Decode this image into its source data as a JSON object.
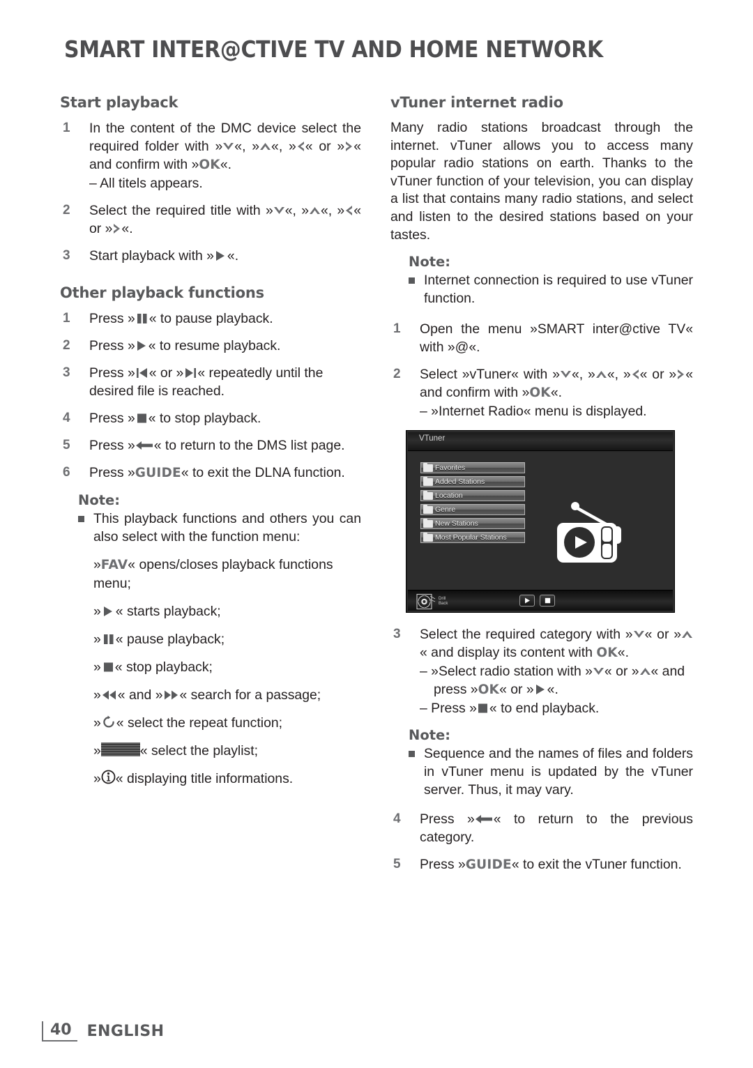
{
  "header": {
    "title": "SMART INTER@CTIVE TV AND HOME NETWORK"
  },
  "left_column": {
    "section1_title": "Start playback",
    "steps1": [
      {
        "num": "1",
        "text_a": "In the content of the DMC device select the required folder with »",
        "text_b": "«, »",
        "text_c": "«, »",
        "text_d": "« or »",
        "text_e": "« and confirm with »",
        "ok": "OK",
        "text_f": "«.",
        "sub": "– All titels appears."
      },
      {
        "num": "2",
        "text_a": "Select the required title with »",
        "text_b": "«, »",
        "text_c": "«, »",
        "text_d": "« or »",
        "text_e": "«."
      },
      {
        "num": "3",
        "text_a": "Start playback with »",
        "text_b": "«."
      }
    ],
    "section2_title": "Other playback functions",
    "steps2": [
      {
        "num": "1",
        "pre": "Press »",
        "post": "« to pause playback."
      },
      {
        "num": "2",
        "pre": "Press »",
        "post": "« to resume playback."
      },
      {
        "num": "3",
        "pre": "Press »",
        "mid": "« or »",
        "post": "« repeatedly until the desired file is reached."
      },
      {
        "num": "4",
        "pre": "Press »",
        "post": "« to stop playback."
      },
      {
        "num": "5",
        "pre": "Press »",
        "post": "« to return to the DMS list page."
      },
      {
        "num": "6",
        "pre": "Press »",
        "key": "GUIDE",
        "post": "« to exit the DLNA function."
      }
    ],
    "note": {
      "title": "Note:",
      "bullet": "This playback functions and others you can also select with the function menu:",
      "lines": [
        {
          "pre": "»",
          "key": "FAV",
          "post": "« opens/closes playback functions menu;"
        },
        {
          "pre": "»",
          "post": "« starts playback;",
          "icon": "play-icon"
        },
        {
          "pre": "»",
          "post": "« pause playback;",
          "icon": "pause-icon"
        },
        {
          "pre": "»",
          "post": "« stop playback;",
          "icon": "stop-icon"
        },
        {
          "pre": "»",
          "mid": "« and »",
          "post": "« search for a passage;",
          "icon": "rewind-icon",
          "icon2": "fast-forward-icon"
        },
        {
          "pre": "»",
          "post": "« select the repeat function;",
          "icon": "repeat-icon"
        },
        {
          "pre": "»",
          "post": "« select the playlist;",
          "icon": "playlist-icon"
        },
        {
          "pre": "»",
          "post": "« displaying title informations.",
          "icon": "info-icon"
        }
      ]
    }
  },
  "right_column": {
    "section_title": "vTuner internet radio",
    "intro": "Many radio stations broadcast through the internet. vTuner allows you to access many popular radio stations on earth. Thanks to the vTuner function of your television, you can display a list that contains many radio stations, and select and listen to the desired stations based on your tastes.",
    "note1": {
      "title": "Note:",
      "bullet": "Internet connection is required to use vTuner function."
    },
    "steps": [
      {
        "num": "1",
        "text_a": "Open the menu »SMART inter@ctive TV« with »@«."
      },
      {
        "num": "2",
        "text_a": "Select »vTuner« with »",
        "text_b": "«, »",
        "text_c": "«, »",
        "text_d": "« or »",
        "text_e": "« and confirm with »",
        "ok": "OK",
        "text_f": "«.",
        "sub": "– »Internet Radio« menu is displayed."
      }
    ],
    "steps_after": [
      {
        "num": "3",
        "text_a": "Select the required category with »",
        "text_b": "« or »",
        "text_c": "« and display its content with ",
        "ok": "OK",
        "text_d": "«.",
        "sub1_a": "– »Select radio station with »",
        "sub1_b": "« or »",
        "sub1_c": "« and press »",
        "sub1_ok": "OK",
        "sub1_d": "« or »",
        "sub1_e": "«.",
        "sub2_a": "– Press »",
        "sub2_b": "« to end playback."
      },
      {
        "num": "4",
        "pre": "Press »",
        "post": "« to return to the previous category."
      },
      {
        "num": "5",
        "pre": "Press »",
        "key": "GUIDE",
        "post": "« to exit the vTuner function."
      }
    ],
    "note2": {
      "title": "Note:",
      "bullet": "Sequence and the names of files and folders in vTuner menu is updated by the vTuner server. Thus, it may vary."
    }
  },
  "tv_screenshot": {
    "title": "VTuner",
    "menu_items": [
      "Favorites",
      "Added Stations",
      "Location",
      "Genre",
      "New Stations",
      "Most Popular Stations"
    ],
    "drill_label_line1": "Drill",
    "drill_label_line2": "Back"
  },
  "footer": {
    "page_number": "40",
    "language": "ENGLISH"
  },
  "colors": {
    "heading_gray": "#58595b",
    "body_black": "#231f20",
    "key_gray": "#6d6e71"
  }
}
